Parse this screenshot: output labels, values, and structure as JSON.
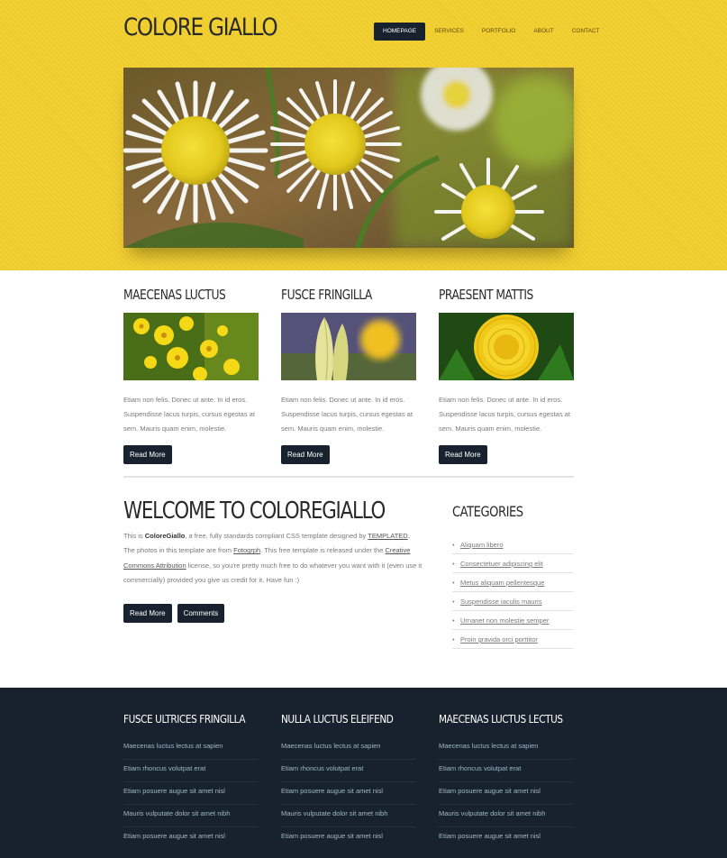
{
  "site": {
    "logo": "COLORE GIALLO"
  },
  "menu": [
    {
      "label": "HOMEPAGE",
      "active": true
    },
    {
      "label": "SERVICES"
    },
    {
      "label": "PORTFOLIO"
    },
    {
      "label": "ABOUT"
    },
    {
      "label": "CONTACT"
    }
  ],
  "columns": [
    {
      "title": "MAECENAS LUCTUS",
      "text": "Etiam non felis. Donec ut ante. In id eros. Suspendisse lacus turpis, cursus egestas at sem. Mauris quam enim, molestie.",
      "button": "Read More"
    },
    {
      "title": "FUSCE FRINGILLA",
      "text": "Etiam non felis. Donec ut ante. In id eros. Suspendisse lacus turpis, cursus egestas at sem. Mauris quam enim, molestie.",
      "button": "Read More"
    },
    {
      "title": "PRAESENT MATTIS",
      "text": "Etiam non felis. Donec ut ante. In id eros. Suspendisse lacus turpis, cursus egestas at sem. Mauris quam enim, molestie.",
      "button": "Read More"
    }
  ],
  "welcome": {
    "title": "WELCOME TO COLOREGIALLO",
    "t1": "This is ",
    "brand": "ColoreGiallo",
    "t2": ", a free, fully standards compliant CSS template designed by ",
    "link1": "TEMPLATED",
    "t3": ". The photos in this template are from ",
    "link2": "Fotogrph",
    "t4": ". This free template is released under the ",
    "link3": "Creative Commons Attribution",
    "t5": " license, so you're pretty much free to do whatever you want with it (even use it commercially) provided you give us credit for it. Have fun :)",
    "read_more": "Read More",
    "comments": "Comments"
  },
  "categories": {
    "title": "CATEGORIES",
    "items": [
      "Aliquam libero",
      "Consectetuer adipiscing elit",
      "Metus aliquam pellentesque",
      "Suspendisse iaculis mauris",
      "Urnanet non molestie semper",
      "Proin gravida orci porttitor"
    ]
  },
  "footer": [
    {
      "title": "FUSCE ULTRICES FRINGILLA",
      "links": [
        "Maecenas luctus lectus at sapien",
        "Etiam rhoncus volutpat erat",
        "Etiam posuere augue sit amet nisl",
        "Mauris vulputate dolor sit amet nibh",
        "Etiam posuere augue sit amet nisl"
      ]
    },
    {
      "title": "NULLA LUCTUS ELEIFEND",
      "links": [
        "Maecenas luctus lectus at sapien",
        "Etiam rhoncus volutpat erat",
        "Etiam posuere augue sit amet nisl",
        "Mauris vulputate dolor sit amet nibh",
        "Etiam posuere augue sit amet nisl"
      ]
    },
    {
      "title": "MAECENAS LUCTUS LECTUS",
      "links": [
        "Maecenas luctus lectus at sapien",
        "Etiam rhoncus volutpat erat",
        "Etiam posuere augue sit amet nisl",
        "Mauris vulputate dolor sit amet nibh",
        "Etiam posuere augue sit amet nisl"
      ]
    }
  ],
  "colors": {
    "header_bg": "#f2cf2e",
    "dark": "#18222e",
    "footer_link": "#9fb8c6"
  }
}
